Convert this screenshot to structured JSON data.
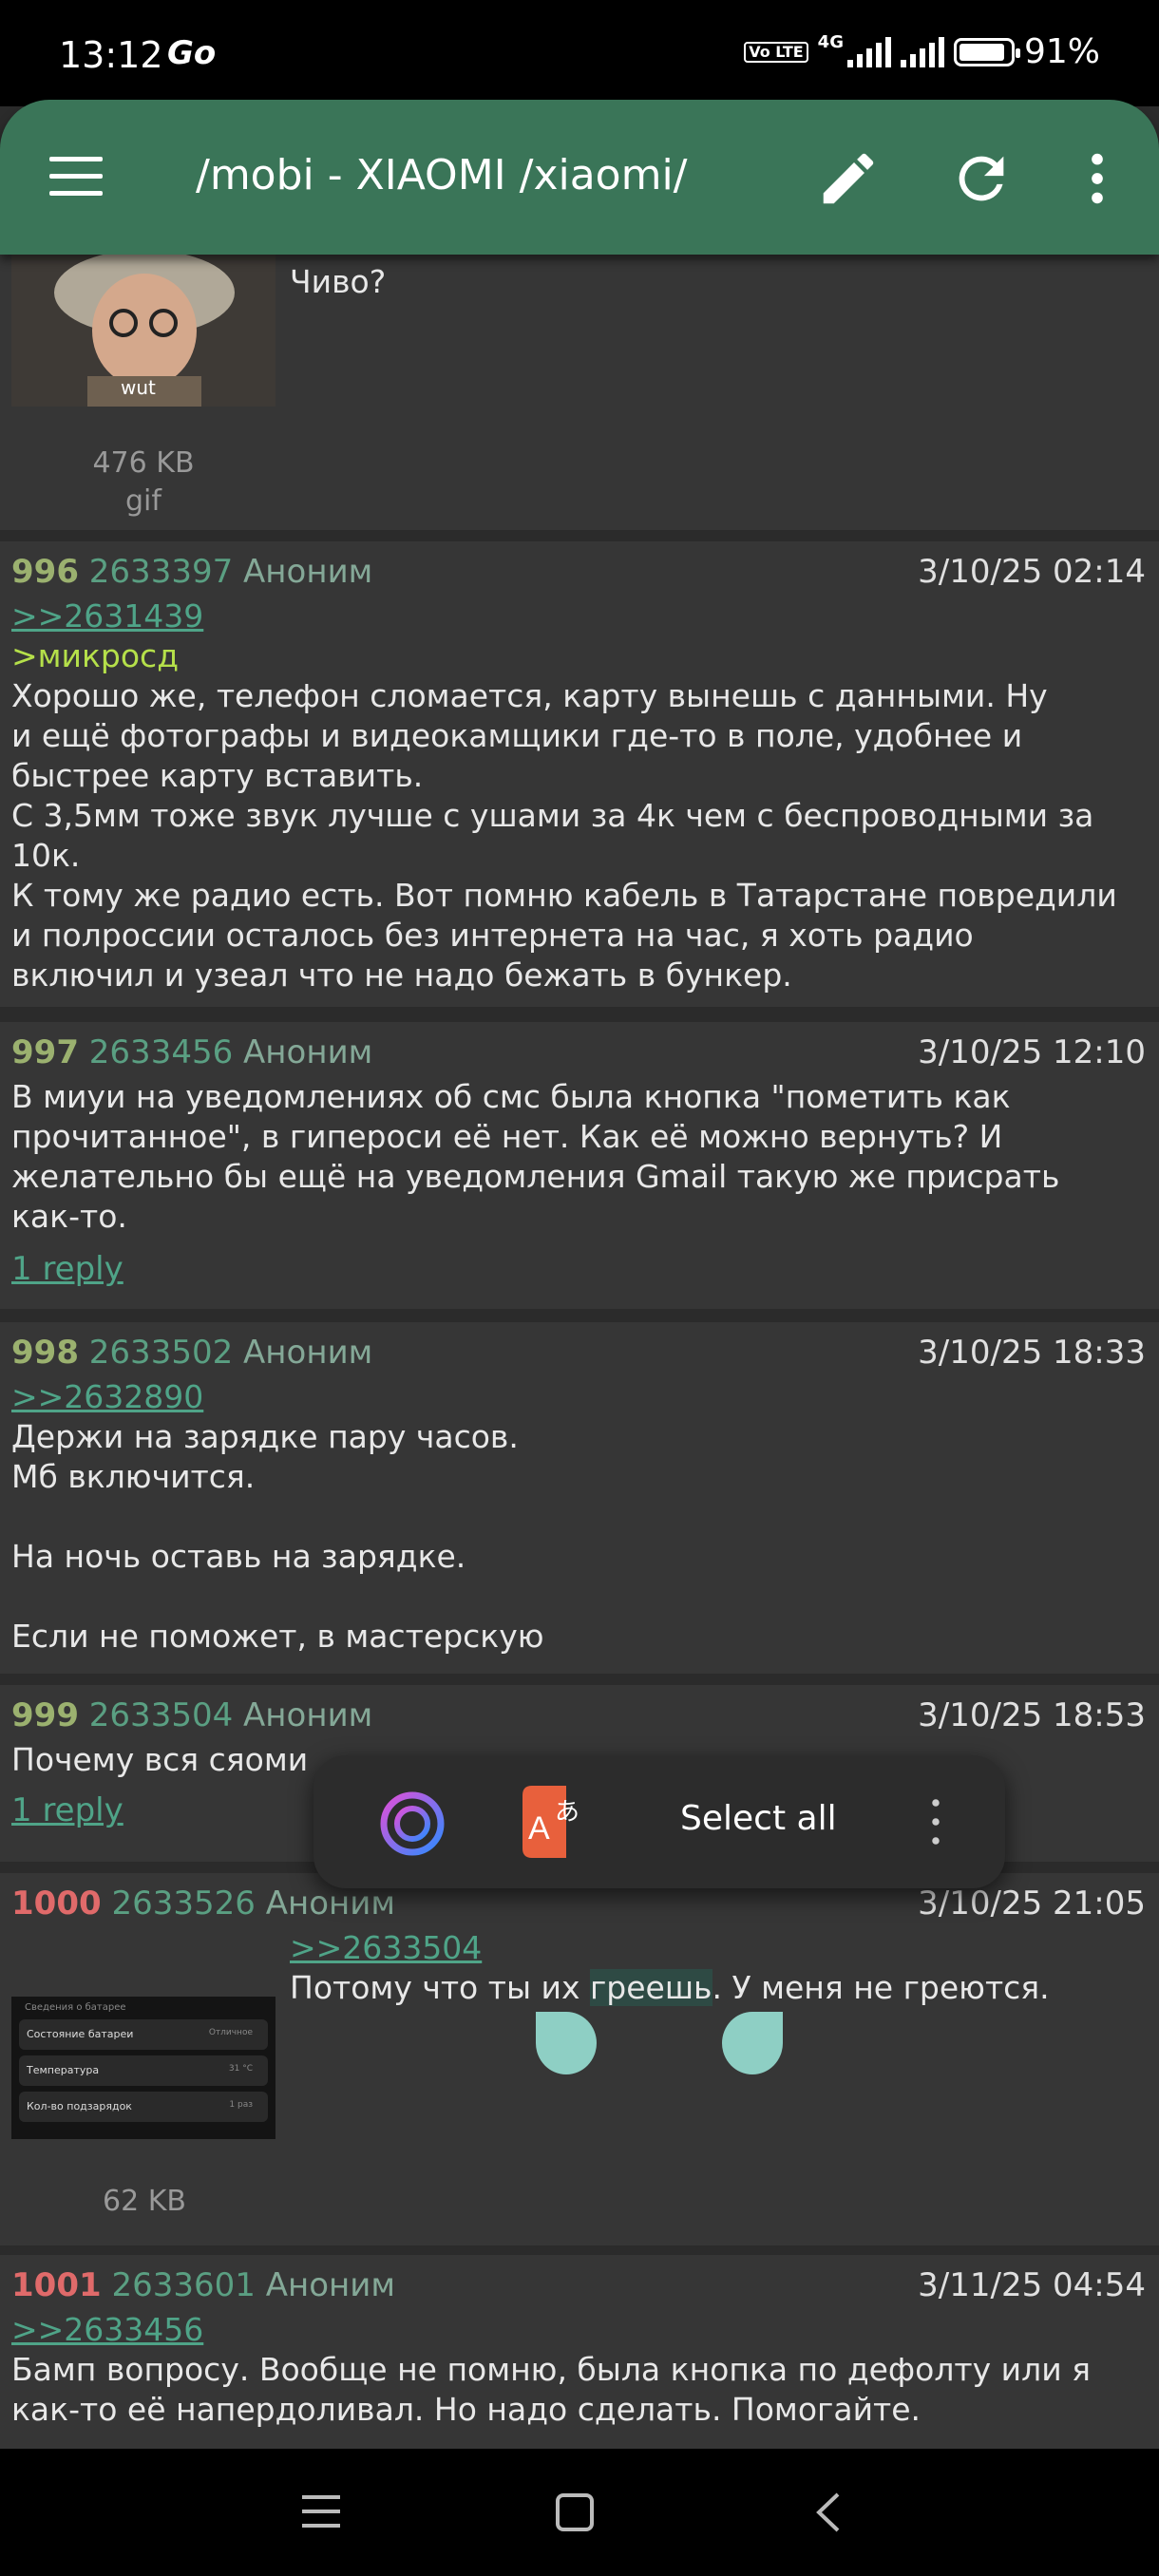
{
  "status_bar": {
    "time": "13:12",
    "extra": "Go",
    "network": "4G",
    "volte": "Vo LTE",
    "battery": "91%",
    "battery_level": 0.91
  },
  "toolbar": {
    "title": "/mobi -  XIAOMI /xiaomi/"
  },
  "post_top": {
    "text": "Чиво?",
    "thumb_caption": "wut",
    "file_size": "476 KB",
    "file_type": "gif"
  },
  "posts": [
    {
      "num": "996",
      "id": "2633397",
      "name": "Аноним",
      "date": "3/10/25 02:14",
      "link": ">>2631439",
      "greentext": ">микросд",
      "text": "Хорошо же, телефон сломается, карту вынешь с данными. Ну\nи ещё фотографы и видеокамщики где-то в поле, удобнее и\nбыстрее карту вставить.\nС 3,5мм тоже звук лучше с ушами за 4к чем с беспроводными за\n10к.\nК тому же радио есть. Вот помню кабель в Татарстане повредили\nи полроссии осталось без интернета на час, я хоть радио\nвключил и узеал что не надо бежать в бункер."
    },
    {
      "num": "997",
      "id": "2633456",
      "name": "Аноним",
      "date": "3/10/25 12:10",
      "text": "В миуи на уведомлениях об смс была кнопка \"пометить как\nпрочитанное\", в гипероси её нет. Как её можно вернуть? И\nжелательно бы ещё на уведомления Gmail такую же присрать\nкак-то.",
      "reply": "1 reply"
    },
    {
      "num": "998",
      "id": "2633502",
      "name": "Аноним",
      "date": "3/10/25 18:33",
      "link": ">>2632890",
      "text": "Держи на зарядке пару часов.\nМб включится.\n\nНа ночь оставь на зарядке.\n\nЕсли не поможет, в мастерскую"
    },
    {
      "num": "999",
      "id": "2633504",
      "name": "Аноним",
      "date": "3/10/25 18:53",
      "text": "Почему вся сяоми",
      "reply": "1 reply"
    },
    {
      "num": "1000",
      "id": "2633526",
      "name": "Аноним",
      "date": "3/10/25 21:05",
      "link": ">>2633504",
      "text_before": "Потому что ты их ",
      "text_selected": "греешь",
      "text_after": ". У меня не греются.",
      "file_size": "62 KB",
      "thumb_title": "Сведения о батарее",
      "thumb_rows": [
        {
          "label": "Состояние батареи",
          "value": "Отличное"
        },
        {
          "label": "Температура",
          "value": "31 °C"
        },
        {
          "label": "Кол-во подзарядок",
          "value": "1 раз"
        }
      ]
    },
    {
      "num": "1001",
      "id": "2633601",
      "name": "Аноним",
      "date": "3/11/25 04:54",
      "link": ">>2633456",
      "text": "Бамп вопросу. Вообще не помню, была кнопка по дефолту или я\nкак-то её напердоливал. Но надо сделать. Помогайте."
    }
  ],
  "popup": {
    "select_all": "Select all"
  },
  "colors": {
    "toolbar": "#3a7558",
    "post_bg": "#363636",
    "divider": "#222222",
    "link": "#4fa488",
    "greentext": "#b5e04a",
    "num_green": "#9bb16f",
    "num_red": "#e06a6a"
  }
}
